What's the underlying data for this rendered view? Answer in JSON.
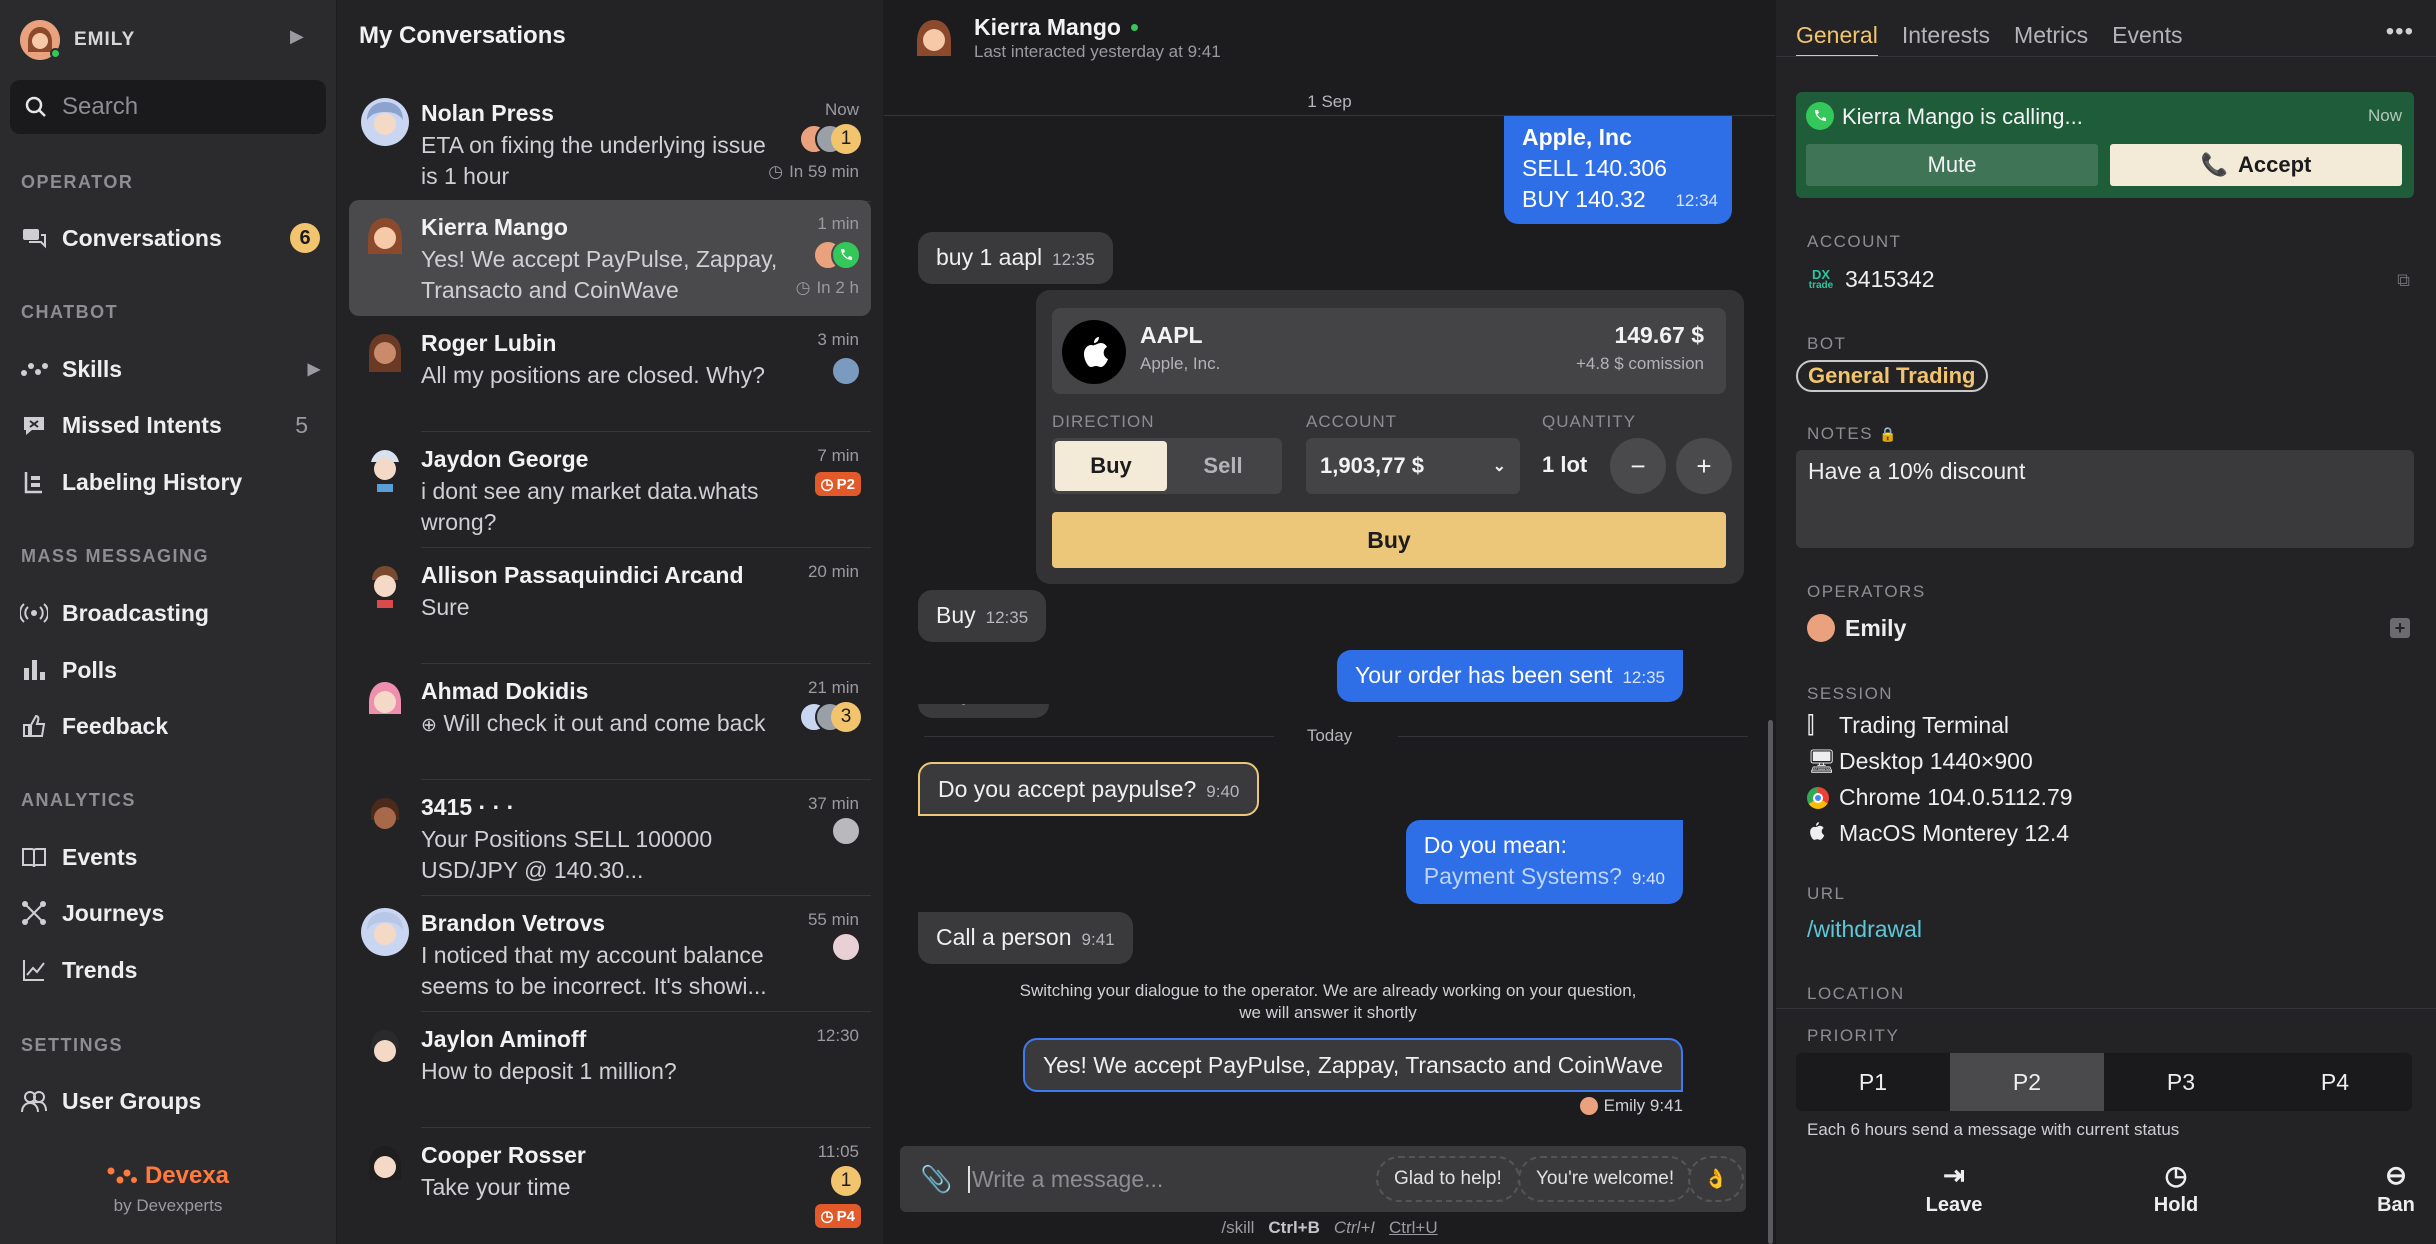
{
  "sidebar": {
    "user_name": "EMILY",
    "search_placeholder": "Search",
    "sections": {
      "operator": "OPERATOR",
      "chatbot": "CHATBOT",
      "mass": "MASS MESSAGING",
      "analytics": "ANALYTICS",
      "settings": "SETTINGS"
    },
    "items": {
      "conversations": "Conversations",
      "conversations_count": "6",
      "skills": "Skills",
      "missed_intents": "Missed Intents",
      "missed_count": "5",
      "labeling": "Labeling History",
      "broadcasting": "Broadcasting",
      "polls": "Polls",
      "feedback": "Feedback",
      "events": "Events",
      "journeys": "Journeys",
      "trends": "Trends",
      "user_groups": "User Groups"
    },
    "brand": "Devexa",
    "brand_sub": "by Devexperts"
  },
  "conversations": {
    "title": "My Conversations",
    "items": [
      {
        "name": "Nolan Press",
        "msg": "ETA on fixing the underlying issue is 1 hour",
        "time": "Now",
        "count": "1",
        "due": "In 59 min"
      },
      {
        "name": "Kierra Mango",
        "msg": "Yes! We accept PayPulse, Zappay, Transacto and CoinWave",
        "time": "1 min",
        "due": "In 2 h"
      },
      {
        "name": "Roger Lubin",
        "msg": "All my positions are closed. Why?",
        "time": "3 min"
      },
      {
        "name": "Jaydon George",
        "msg": "i dont see any market data.whats wrong?",
        "time": "7 min",
        "tag": "P2"
      },
      {
        "name": "Allison Passaquindici Arcand",
        "msg": "Sure",
        "time": "20 min"
      },
      {
        "name": "Ahmad Dokidis",
        "msg": "Will check it out and come back",
        "time": "21 min",
        "count": "3"
      },
      {
        "name": "3415 · · ·",
        "msg": "Your Positions SELL 100000 USD/JPY @ 140.30...",
        "time": "37 min"
      },
      {
        "name": "Brandon Vetrovs",
        "msg": "I noticed that my account balance seems to be incorrect. It's showi...",
        "time": "55 min"
      },
      {
        "name": "Jaylon Aminoff",
        "msg": "How to deposit 1 million?",
        "time": "12:30"
      },
      {
        "name": "Cooper Rosser",
        "msg": "Take your time",
        "time": "11:05",
        "count": "1",
        "tag": "P4"
      }
    ]
  },
  "chat": {
    "contact_name": "Kierra Mango",
    "contact_status": "Last interacted yesterday at 9:41",
    "date_sep_1": "1 Sep",
    "date_sep_2": "Today",
    "msg_apple_title": "Apple, Inc",
    "msg_apple_l1": "SELL 140.306",
    "msg_apple_l2": "BUY 140.32",
    "msg_apple_time": "12:34",
    "msg_buy1": "buy 1 aapl",
    "msg_buy1_time": "12:35",
    "trade": {
      "symbol": "AAPL",
      "company": "Apple, Inc.",
      "price": "149.67 $",
      "commission": "+4.8 $ comission",
      "direction_label": "DIRECTION",
      "account_label": "ACCOUNT",
      "quantity_label": "QUANTITY",
      "buy": "Buy",
      "sell": "Sell",
      "account_value": "1,903,77 $",
      "quantity": "1 lot",
      "minus": "−",
      "plus": "+",
      "submit": "Buy"
    },
    "msg_buy2": "Buy",
    "msg_buy2_time": "12:35",
    "msg_order": "Your order has been sent",
    "msg_order_time": "12:35",
    "msg_hidden_fragment": "Buy 12:35",
    "msg_paypulse": "Do you accept paypulse?",
    "msg_paypulse_time": "9:40",
    "msg_mean": "Do you mean:",
    "msg_mean_link": "Payment Systems?",
    "msg_mean_time": "9:40",
    "msg_call": "Call a person",
    "msg_call_time": "9:41",
    "system_l1": "Switching your dialogue to the operator. We are already working on your question,",
    "system_l2": "we will answer it shortly",
    "msg_reply": "Yes! We accept PayPulse, Zappay, Transacto and CoinWave",
    "msg_reply_meta": "Emily 9:41",
    "input_placeholder": "Write a message...",
    "chip1": "Glad to help!",
    "chip2": "You're welcome!",
    "chip3": "👌",
    "hint_skill": "/skill",
    "hint_b": "Ctrl+B",
    "hint_i": "Ctrl+I",
    "hint_u": "Ctrl+U"
  },
  "details": {
    "tabs": [
      "General",
      "Interests",
      "Metrics",
      "Events"
    ],
    "call_text": "Kierra Mango is calling...",
    "call_time": "Now",
    "mute": "Mute",
    "accept": "Accept",
    "account_label": "ACCOUNT",
    "account_logo_top": "DX",
    "account_logo_bottom": "trade",
    "account_value": "3415342",
    "bot_label": "BOT",
    "bot_value": "General Trading",
    "notes_label": "NOTES",
    "notes_value": "Have a 10% discount",
    "operators_label": "OPERATORS",
    "operator_name": "Emily",
    "session_label": "SESSION",
    "session": [
      "Trading Terminal",
      "Desktop 1440×900",
      "Chrome 104.0.5112.79",
      "MacOS Monterey 12.4"
    ],
    "url_label": "URL",
    "url_value": "/withdrawal",
    "location_label": "LOCATION",
    "priority_label": "PRIORITY",
    "priorities": [
      "P1",
      "P2",
      "P3",
      "P4"
    ],
    "priority_note": "Each 6 hours send a message with current status",
    "leave": "Leave",
    "hold": "Hold",
    "ban": "Ban"
  },
  "colors": {
    "accent": "#f2c46d",
    "blue": "#2e6ee6",
    "call_green": "#1f5c3a",
    "tag_red": "#e25a2a"
  }
}
